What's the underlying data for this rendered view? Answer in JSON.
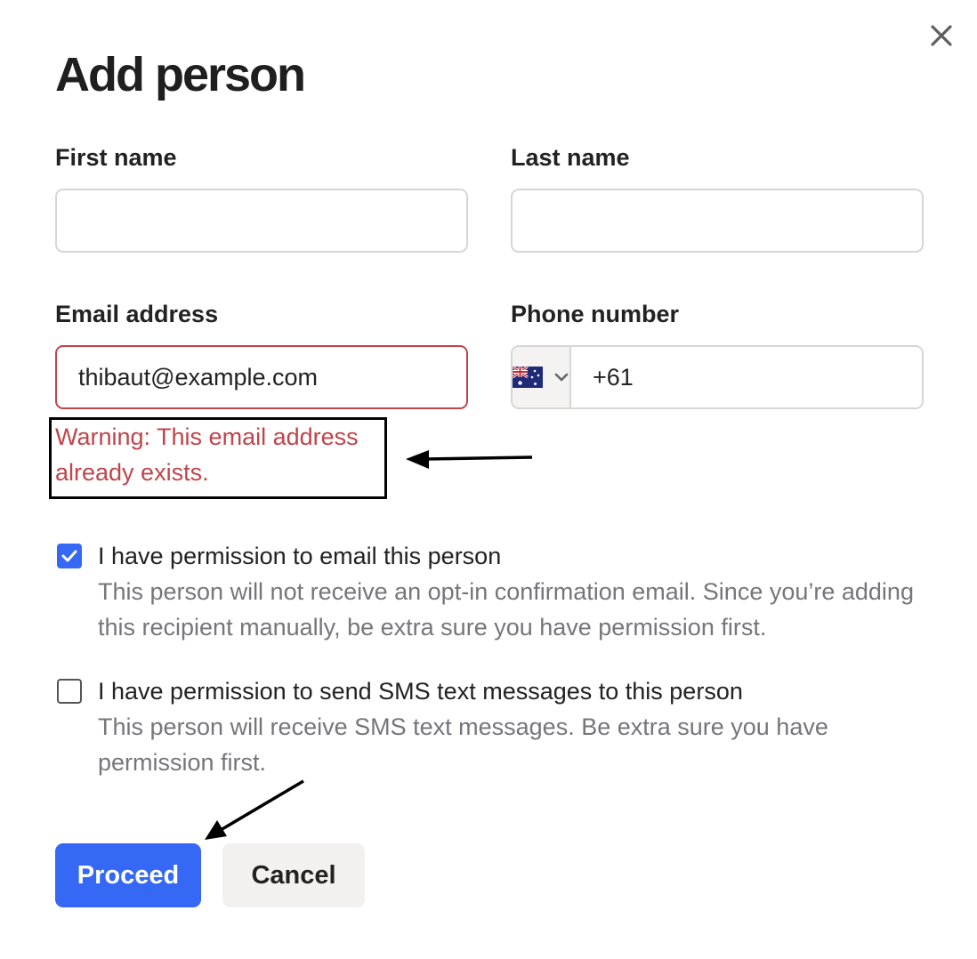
{
  "dialog": {
    "title": "Add person",
    "close_icon": "close-icon"
  },
  "form": {
    "first_name": {
      "label": "First name",
      "value": ""
    },
    "last_name": {
      "label": "Last name",
      "value": ""
    },
    "email": {
      "label": "Email address",
      "value": "thibaut@example.com"
    },
    "phone": {
      "label": "Phone number",
      "country_flag_icon": "australia-flag-icon",
      "dropdown_icon": "chevron-down-icon",
      "value": "+61"
    },
    "email_warning": "Warning: This email address already exists."
  },
  "permissions": [
    {
      "checked": true,
      "title": "I have permission to email this person",
      "description": "This person will not receive an opt-in confirmation email. Since you’re adding this recipient manually, be extra sure you have permission first."
    },
    {
      "checked": false,
      "title": "I have permission to send SMS text messages to this person",
      "description": "This person will receive SMS text messages. Be extra sure you have permission first."
    }
  ],
  "actions": {
    "proceed_label": "Proceed",
    "cancel_label": "Cancel"
  },
  "colors": {
    "primary": "#3568f5",
    "error": "#c0444b",
    "annotation": "#000000"
  }
}
